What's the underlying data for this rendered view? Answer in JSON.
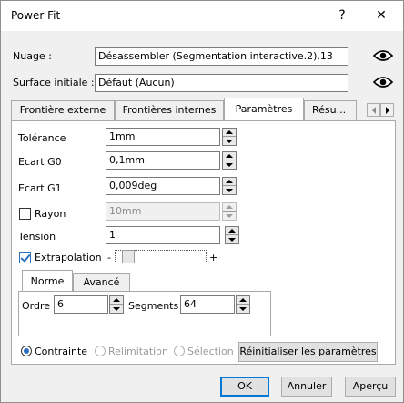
{
  "window": {
    "title": "Power Fit",
    "help_label": "?",
    "close_label": "✕"
  },
  "fields": {
    "nuage_label": "Nuage :",
    "nuage_value": "Désassembler (Segmentation interactive.2).13",
    "surface_label": "Surface initiale :",
    "surface_value": "Défaut (Aucun)"
  },
  "tabs": [
    {
      "label": "Frontière externe"
    },
    {
      "label": "Frontières internes"
    },
    {
      "label": "Paramètres"
    },
    {
      "label": "Résu..."
    }
  ],
  "params": {
    "tolerance_label": "Tolérance",
    "tolerance_value": "1mm",
    "ecart_g0_label": "Ecart G0",
    "ecart_g0_value": "0,1mm",
    "ecart_g1_label": "Ecart G1",
    "ecart_g1_value": "0,009deg",
    "rayon_label": "Rayon",
    "rayon_value": "10mm",
    "rayon_checked": false,
    "tension_label": "Tension",
    "tension_value": "1",
    "extrapolation_label": "Extrapolation",
    "extrapolation_checked": true,
    "slider_minus": "-",
    "slider_plus": "+"
  },
  "subtabs": [
    {
      "label": "Norme"
    },
    {
      "label": "Avancé"
    }
  ],
  "norme": {
    "ordre_label": "Ordre",
    "ordre_value": "6",
    "segments_label": "Segments",
    "segments_value": "64"
  },
  "mode": {
    "contrainte_label": "Contrainte",
    "relimitation_label": "Relimitation",
    "selection_label": "Sélection",
    "reset_label": "Réinitialiser les paramètres"
  },
  "footer": {
    "ok_label": "OK",
    "cancel_label": "Annuler",
    "preview_label": "Aperçu"
  },
  "colors": {
    "accent": "#0078d7",
    "dialog_bg": "#f0f0f0"
  }
}
